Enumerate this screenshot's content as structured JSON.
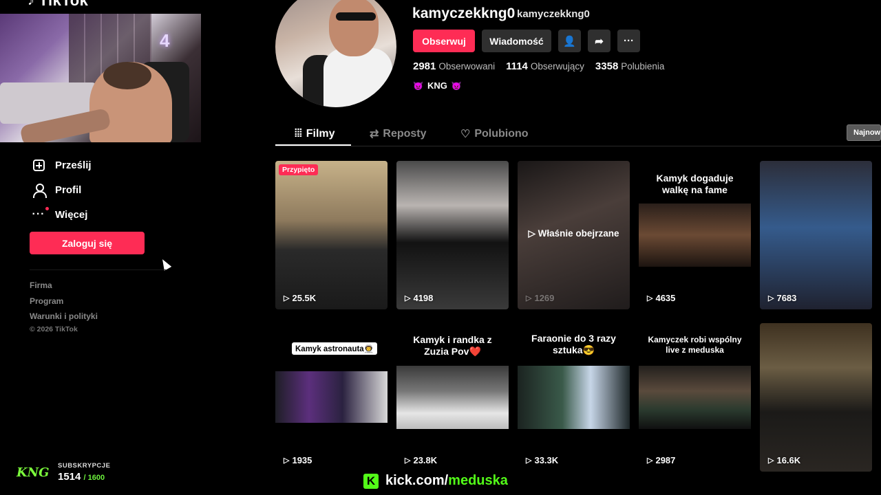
{
  "brand": {
    "logo_text": "TikTok"
  },
  "sidebar": {
    "items": [
      {
        "label": "Prześlij",
        "icon": "upload-plus-icon"
      },
      {
        "label": "Profil",
        "icon": "user-icon"
      },
      {
        "label": "Więcej",
        "icon": "more-dots-icon"
      }
    ],
    "login_button": "Zaloguj się",
    "footer_links": [
      "Firma",
      "Program",
      "Warunki i polityki"
    ],
    "copyright": "© 2026 TikTok"
  },
  "profile": {
    "username": "kamyczekkng0",
    "nickname": "kamyczekkng0",
    "follow_button": "Obserwuj",
    "message_button": "Wiadomość",
    "stats": [
      {
        "value": "2981",
        "label": "Obserwowani"
      },
      {
        "value": "1114",
        "label": "Obserwujący"
      },
      {
        "value": "3358",
        "label": "Polubienia"
      }
    ],
    "bio": "KNG",
    "bio_emoji": "👿"
  },
  "tabs": [
    {
      "label": "Filmy",
      "icon": "grid-icon",
      "active": true
    },
    {
      "label": "Reposty",
      "icon": "repost-icon",
      "active": false
    },
    {
      "label": "Polubiono",
      "icon": "heart-icon",
      "active": false
    }
  ],
  "sort_button": "Najnowsze",
  "videos": [
    {
      "views": "25.5K",
      "pinned_label": "Przypięto"
    },
    {
      "views": "4198"
    },
    {
      "views": "1269",
      "overlay": "Właśnie obejrzane"
    },
    {
      "views": "4635",
      "title": "Kamyk dogaduje walkę na fame"
    },
    {
      "views": "7683"
    },
    {
      "views": "1935",
      "caption": "Kamyk astronauta👨‍🚀"
    },
    {
      "views": "23.8K",
      "title": "Kamyk i randka z Zuzia Pov❤️"
    },
    {
      "views": "33.3K",
      "title": "Faraonie do 3 razy sztuka😎"
    },
    {
      "views": "2987",
      "title": "Kamyczek robi wspólny live z meduska"
    },
    {
      "views": "16.6K"
    }
  ],
  "stream": {
    "subs_label": "SUBSKRYPCJE",
    "subs_count": "1514",
    "subs_goal": "/ 1600",
    "logo_text": "KNG",
    "kick_domain": "kick.com/",
    "kick_channel": "meduska"
  },
  "colors": {
    "accent": "#fe2c55",
    "kick_green": "#53fc18",
    "background": "#000000"
  }
}
